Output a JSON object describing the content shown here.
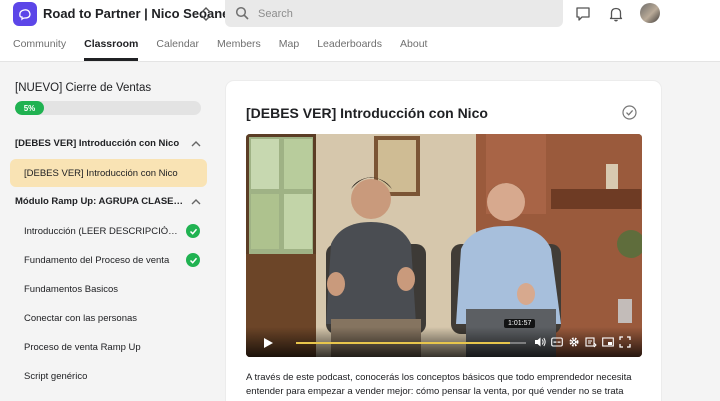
{
  "header": {
    "community_name": "Road to Partner | Nico Seoane",
    "search_placeholder": "Search"
  },
  "tabs": [
    {
      "label": "Community"
    },
    {
      "label": "Classroom"
    },
    {
      "label": "Calendar"
    },
    {
      "label": "Members"
    },
    {
      "label": "Map"
    },
    {
      "label": "Leaderboards"
    },
    {
      "label": "About"
    }
  ],
  "sidebar": {
    "course_title": "[NUEVO] Cierre de Ventas",
    "progress_percent": 5,
    "progress_label": "5%",
    "sections": [
      {
        "title": "[DEBES VER] Introducción con Nico"
      },
      {
        "title": "Módulo Ramp Up: AGRUPA CLASES..."
      }
    ],
    "lessons": [
      {
        "label": "[DEBES VER] Introducción con Nico"
      },
      {
        "label": "Introducción (LEER DESCRIPCIÓN ..."
      },
      {
        "label": "Fundamento del Proceso de venta"
      },
      {
        "label": "Fundamentos Basicos"
      },
      {
        "label": "Conectar con las personas"
      },
      {
        "label": "Proceso de venta Ramp Up"
      },
      {
        "label": "Script genérico"
      }
    ]
  },
  "main": {
    "lesson_title": "[DEBES VER] Introducción con Nico",
    "video": {
      "hover_time": "1:01:57",
      "played_fraction": 0.93
    },
    "description": "A través de este podcast, conocerás los conceptos básicos que todo emprendedor necesita entender para empezar a vender mejor: cómo pensar la venta, por qué vender no se trata"
  },
  "colors": {
    "brand": "#5c46e8",
    "progress": "#20b251",
    "active_lesson_bg": "#f9e3b4",
    "video_progress": "#e8c64c"
  }
}
